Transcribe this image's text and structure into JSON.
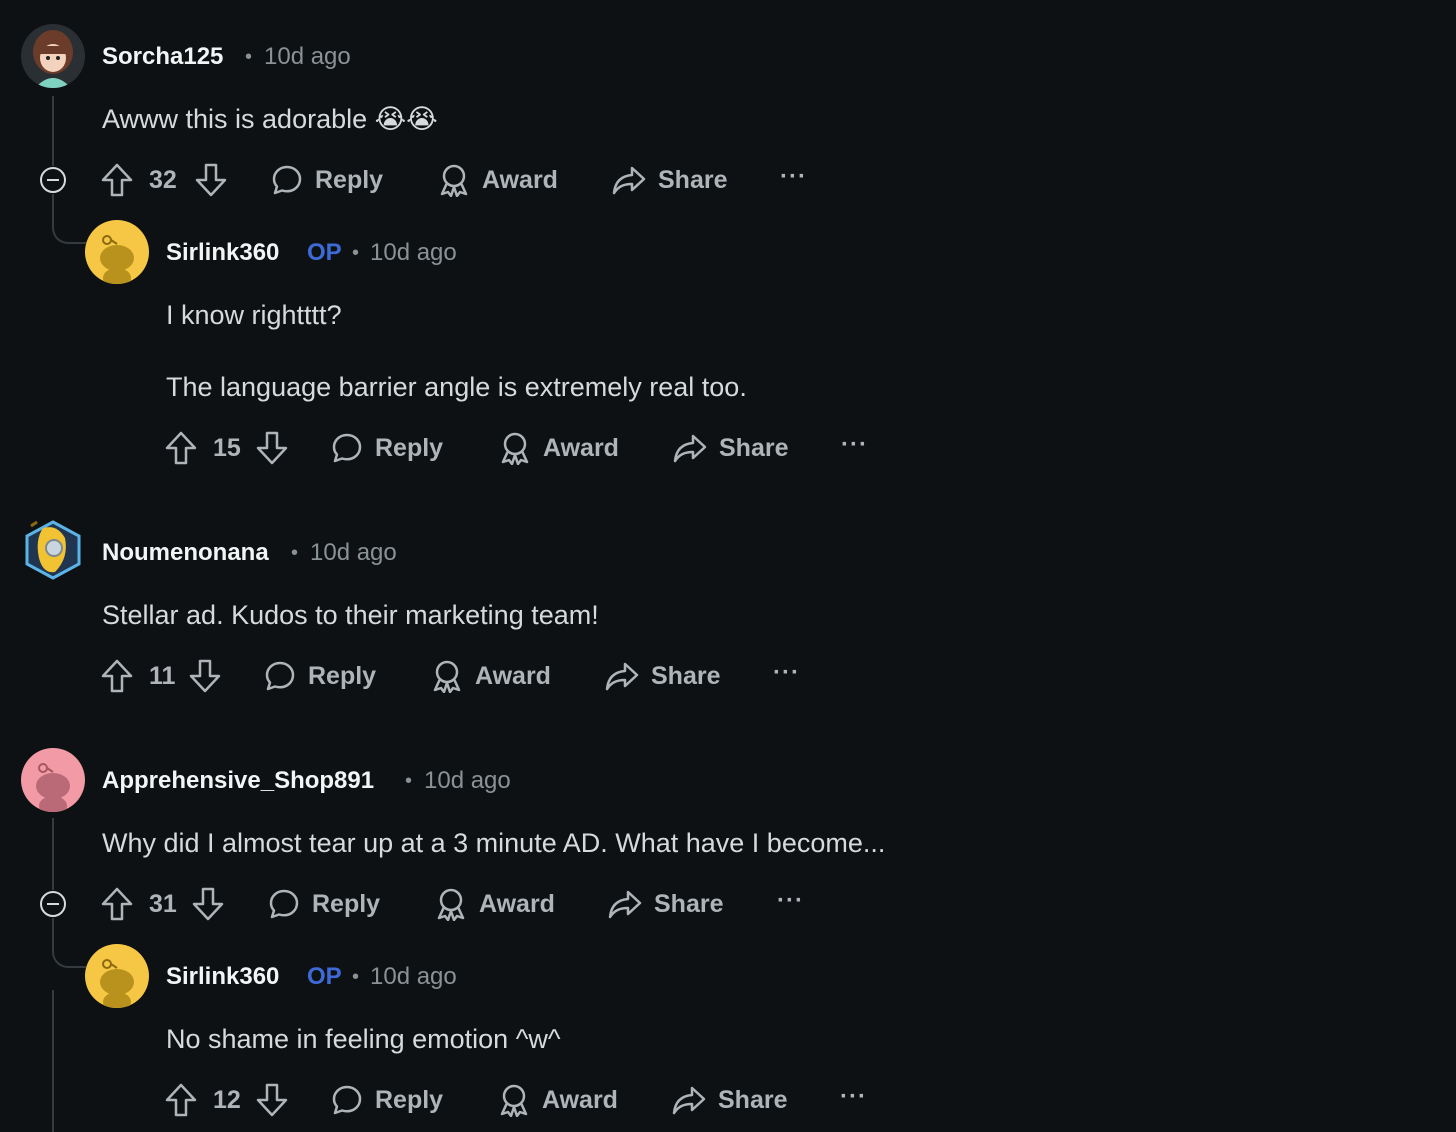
{
  "comments": [
    {
      "user": "Sorcha125",
      "op_badge": "",
      "time": "10d ago",
      "lines": [
        "Awww this is adorable 😭😭"
      ],
      "score": "32",
      "reply_label": "Reply",
      "award_label": "Award",
      "share_label": "Share",
      "more_label": "···"
    },
    {
      "user": "Sirlink360",
      "op_badge": "OP",
      "time": "10d ago",
      "lines": [
        "I know rightttt?",
        "The language barrier angle is extremely real too."
      ],
      "score": "15",
      "reply_label": "Reply",
      "award_label": "Award",
      "share_label": "Share",
      "more_label": "···"
    },
    {
      "user": "Noumenonana",
      "op_badge": "",
      "time": "10d ago",
      "lines": [
        "Stellar ad. Kudos to their marketing team!"
      ],
      "score": "11",
      "reply_label": "Reply",
      "award_label": "Award",
      "share_label": "Share",
      "more_label": "···"
    },
    {
      "user": "Apprehensive_Shop891",
      "op_badge": "",
      "time": "10d ago",
      "lines": [
        "Why did I almost tear up at a 3 minute AD. What have I become..."
      ],
      "score": "31",
      "reply_label": "Reply",
      "award_label": "Award",
      "share_label": "Share",
      "more_label": "···"
    },
    {
      "user": "Sirlink360",
      "op_badge": "OP",
      "time": "10d ago",
      "lines": [
        "No shame in feeling emotion ^w^"
      ],
      "score": "12",
      "reply_label": "Reply",
      "award_label": "Award",
      "share_label": "Share",
      "more_label": "···"
    }
  ],
  "separator": "•",
  "colors": {
    "background": "#0e1113",
    "op_badge": "#3c6bd8",
    "avatar_yellow": "#f6c744",
    "avatar_pink": "#f29aa6"
  }
}
